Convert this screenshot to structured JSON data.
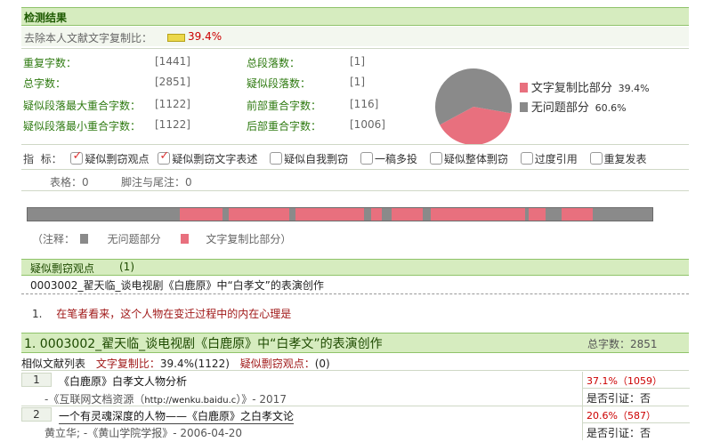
{
  "header": {
    "title": "检测结果"
  },
  "summary": {
    "label": "去除本人文献文字复制比：",
    "value": "39.4%"
  },
  "stats": {
    "left": [
      {
        "label": "重复字数：",
        "value": "[1441]"
      },
      {
        "label": "总字数：",
        "value": "[2851]"
      },
      {
        "label": "疑似段落最大重合字数：",
        "value": "[1122]"
      },
      {
        "label": "疑似段落最小重合字数：",
        "value": "[1122]"
      }
    ],
    "right": [
      {
        "label": "总段落数：",
        "value": "[1]"
      },
      {
        "label": "疑似段落数：",
        "value": "[1]"
      },
      {
        "label": "前部重合字数：",
        "value": "[116]"
      },
      {
        "label": "后部重合字数：",
        "value": "[1006]"
      }
    ]
  },
  "pie": {
    "colors": {
      "copy": "#e8707e",
      "ok": "#8a8a8a"
    },
    "legend": [
      {
        "label": "文字复制比部分",
        "value": "39.4%"
      },
      {
        "label": "无问题部分",
        "value": "60.6%"
      }
    ]
  },
  "chart_data": {
    "type": "pie",
    "slices": [
      {
        "label": "文字复制比部分",
        "value": 39.4
      },
      {
        "label": "无问题部分",
        "value": 60.6
      }
    ]
  },
  "indicators": {
    "label": "指  标：",
    "items": [
      {
        "label": "疑似剽窃观点",
        "checked": true
      },
      {
        "label": "疑似剽窃文字表述",
        "checked": true
      },
      {
        "label": "疑似自我剽窃",
        "checked": false
      },
      {
        "label": "一稿多投",
        "checked": false
      },
      {
        "label": "疑似整体剽窃",
        "checked": false
      },
      {
        "label": "过度引用",
        "checked": false
      },
      {
        "label": "重复发表",
        "checked": false
      }
    ]
  },
  "counts": {
    "tables": "表格：0",
    "footnotes": "脚注与尾注：0"
  },
  "bar": {
    "segments": [
      [
        0.243,
        0.312
      ],
      [
        0.322,
        0.419
      ],
      [
        0.429,
        0.539
      ],
      [
        0.55,
        0.567
      ],
      [
        0.583,
        0.632
      ],
      [
        0.645,
        0.797
      ],
      [
        0.802,
        0.829
      ],
      [
        0.854,
        0.905
      ]
    ]
  },
  "bar_legend": {
    "note": "（注释：",
    "ok": "无问题部分",
    "copy": "文字复制比部分）"
  },
  "plagiarism": {
    "title": "疑似剽窃观点",
    "count": "(1)",
    "doc": "0003002_翟天临_谈电视剧《白鹿原》中“白孝文”的表演创作",
    "items": [
      {
        "num": "1.",
        "text": "在笔者看来，这个人物在变迁过程中的内在心理是"
      }
    ]
  },
  "section": {
    "title": "1. 0003002_翟天临_谈电视剧《白鹿原》中“白孝文”的表演创作",
    "total": "总字数：2851",
    "sub_label": "相似文献列表",
    "ratio_label": "文字复制比：",
    "ratio_value": "39.4%(1122)",
    "view_label": "疑似剽窃观点：",
    "view_value": "(0)"
  },
  "docs": [
    {
      "num": "1",
      "title": "《白鹿原》白孝文人物分析",
      "source_pre": "-《互联网文档资源（",
      "link": "http://wenku.baidu.c",
      "source_post": "）》- 2017",
      "percent": "37.1%（1059）",
      "cite": "是否引证：否"
    },
    {
      "num": "2",
      "title": "一个有灵魂深度的人物——《白鹿原》之白孝文论",
      "source_pre": "黄立华; -《黄山学院学报》- 2006-04-20",
      "link": "",
      "source_post": "",
      "percent": "20.6%（587）",
      "cite": "是否引证：否"
    }
  ]
}
